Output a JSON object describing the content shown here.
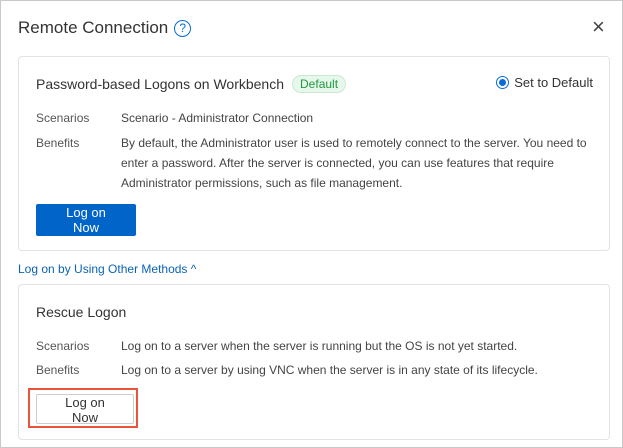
{
  "dialog": {
    "title": "Remote Connection",
    "help_icon": "?",
    "close_icon": "×"
  },
  "primary_method": {
    "title": "Password-based Logons on Workbench",
    "badge": "Default",
    "set_default_label": "Set to Default",
    "set_default_checked": true,
    "scenarios_label": "Scenarios",
    "scenarios": "Scenario - Administrator Connection",
    "benefits_label": "Benefits",
    "benefits": "By default, the Administrator user is used to remotely connect to the server. You need to enter a password. After the server is connected, you can use features that require Administrator permissions, such as file management.",
    "button": "Log on Now"
  },
  "other_methods": {
    "toggle_label": "Log on by Using Other Methods",
    "toggle_icon": "^"
  },
  "rescue": {
    "title": "Rescue Logon",
    "scenarios_label": "Scenarios",
    "scenarios": "Log on to a server when the server is running but the OS is not yet started.",
    "benefits_label": "Benefits",
    "benefits": "Log on to a server by using VNC when the server is in any state of its lifecycle.",
    "button": "Log on Now"
  },
  "colors": {
    "primary": "#0064c8",
    "highlight": "#e8553a",
    "badge": "#1e9a3c"
  }
}
